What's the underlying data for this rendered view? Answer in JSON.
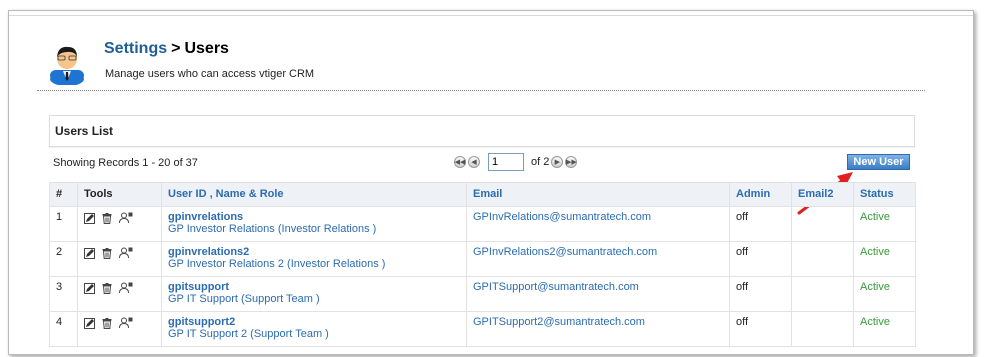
{
  "header": {
    "breadcrumb_root": "Settings",
    "breadcrumb_sep": ">",
    "breadcrumb_current": "Users",
    "subtitle": "Manage users who can access vtiger CRM"
  },
  "list": {
    "title": "Users List",
    "records_text": "Showing Records 1 - 20 of 37",
    "page_value": "1",
    "page_total": "of 2",
    "new_user_label": "New User"
  },
  "table": {
    "columns": [
      "#",
      "Tools",
      "User ID , Name & Role",
      "Email",
      "Admin",
      "Email2",
      "Status"
    ],
    "rows": [
      {
        "num": "1",
        "user_id": "gpinvrelations",
        "name": "GP Investor Relations",
        "role": "(Investor Relations )",
        "email": "GPInvRelations@sumantratech.com",
        "admin": "off",
        "email2": "",
        "status": "Active"
      },
      {
        "num": "2",
        "user_id": "gpinvrelations2",
        "name": "GP Investor Relations 2",
        "role": "(Investor Relations )",
        "email": "GPInvRelations2@sumantratech.com",
        "admin": "off",
        "email2": "",
        "status": "Active"
      },
      {
        "num": "3",
        "user_id": "gpitsupport",
        "name": "GP IT Support",
        "role": "(Support Team )",
        "email": "GPITSupport@sumantratech.com",
        "admin": "off",
        "email2": "",
        "status": "Active"
      },
      {
        "num": "4",
        "user_id": "gpitsupport2",
        "name": "GP IT Support 2",
        "role": "(Support Team )",
        "email": "GPITSupport2@sumantratech.com",
        "admin": "off",
        "email2": "",
        "status": "Active"
      }
    ]
  },
  "icons": {
    "avatar": "user-avatar-icon",
    "edit": "edit-icon",
    "delete": "trash-icon",
    "duplicate": "duplicate-user-icon",
    "first": "first-page-icon",
    "prev": "prev-page-icon",
    "next": "next-page-icon",
    "last": "last-page-icon"
  },
  "colors": {
    "link": "#2b6cb0",
    "active": "#3a9a3a",
    "button": "#3a7cc4",
    "annotation_arrow": "#e02020"
  }
}
